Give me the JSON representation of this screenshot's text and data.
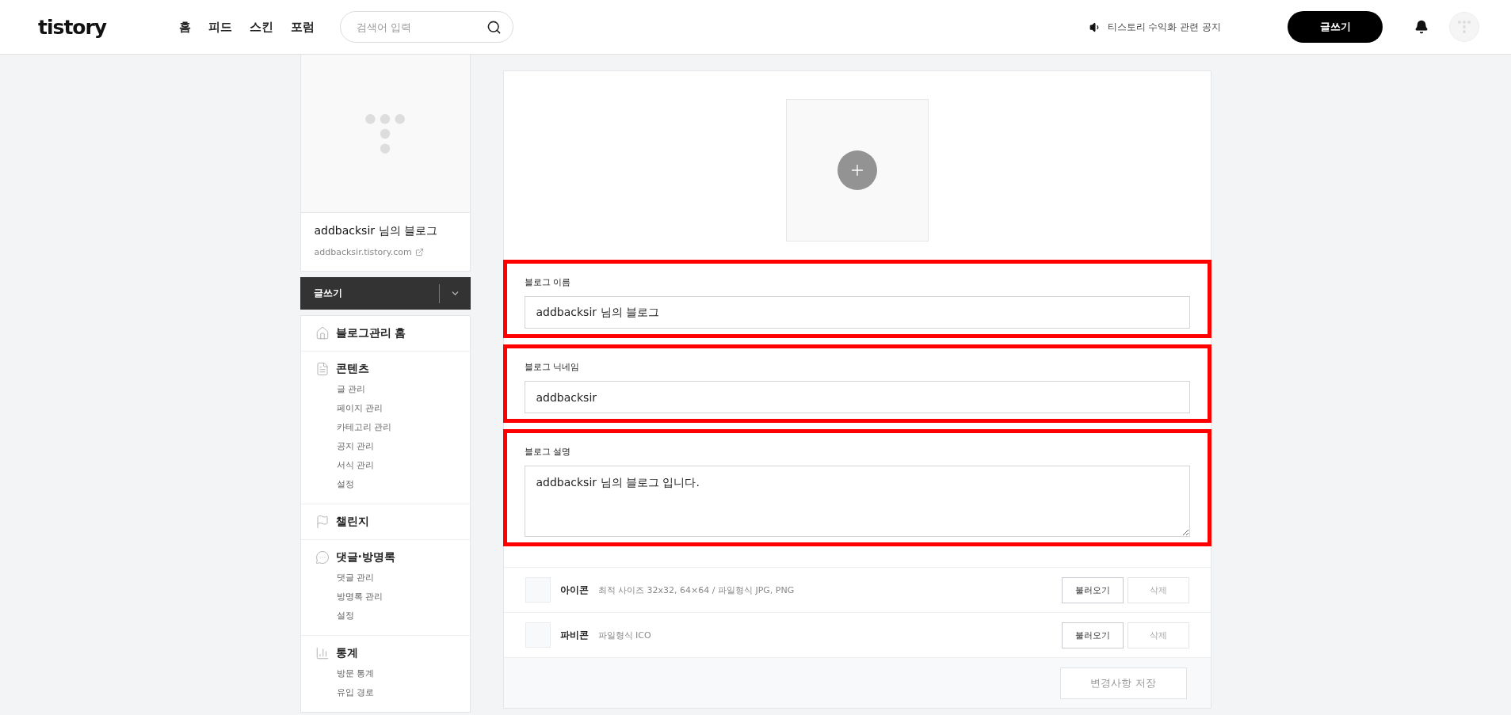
{
  "header": {
    "logo": "tistory",
    "nav": [
      "홈",
      "피드",
      "스킨",
      "포럼"
    ],
    "search": {
      "placeholder": "검색어 입력"
    },
    "notice": "티스토리 수익화 관련 공지",
    "write_button": "글쓰기"
  },
  "sidebar": {
    "blog_name": "addbacksir 님의 블로그",
    "blog_url": "addbacksir.tistory.com",
    "write_button": "글쓰기",
    "menu": [
      {
        "title": "블로그관리 홈"
      },
      {
        "title": "콘텐츠",
        "items": [
          "글 관리",
          "페이지 관리",
          "카테고리 관리",
          "공지 관리",
          "서식 관리",
          "설정"
        ]
      },
      {
        "title": "챌린지"
      },
      {
        "title": "댓글·방명록",
        "items": [
          "댓글 관리",
          "방명록 관리",
          "설정"
        ]
      },
      {
        "title": "통계",
        "items": [
          "방문 통계",
          "유입 경로"
        ]
      }
    ]
  },
  "form": {
    "fields": [
      {
        "label": "블로그 이름",
        "value": "addbacksir 님의 블로그",
        "kind": "input",
        "highlighted": true
      },
      {
        "label": "블로그 닉네임",
        "value": "addbacksir",
        "kind": "input",
        "highlighted": true
      },
      {
        "label": "블로그 설명",
        "value": "addbacksir 님의 블로그 입니다.",
        "kind": "textarea",
        "highlighted": true
      }
    ],
    "image_rows": [
      {
        "name": "아이콘",
        "hint": "최적 사이즈 32x32, 64×64 / 파일형식 JPG, PNG",
        "load_button": "불러오기",
        "delete_button": {
          "label": "삭제",
          "disabled": true
        }
      },
      {
        "name": "파비콘",
        "hint": "파일형식 ICO",
        "load_button": "불러오기",
        "delete_button": {
          "label": "삭제",
          "disabled": true
        }
      }
    ],
    "save_button": {
      "label": "변경사항 저장",
      "disabled": true
    }
  }
}
